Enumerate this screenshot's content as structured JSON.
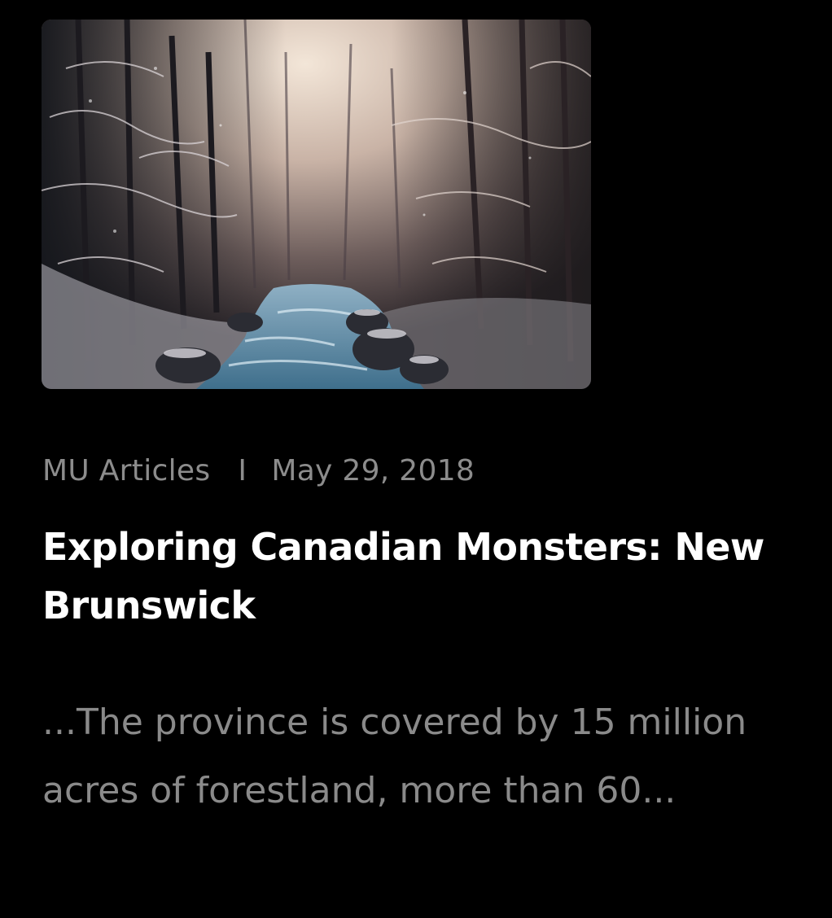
{
  "article": {
    "image_alt": "Snowy forest with a stream",
    "category": "MU Articles",
    "separator": "I",
    "date": "May 29, 2018",
    "title": "Exploring Canadian Monsters: New Brunswick",
    "excerpt": "...The province is covered by 15 million acres of forestland, more than 60..."
  },
  "colors": {
    "background": "#000000",
    "title": "#ffffff",
    "meta": "#8c8c8c",
    "excerpt": "#8a8a8a"
  }
}
